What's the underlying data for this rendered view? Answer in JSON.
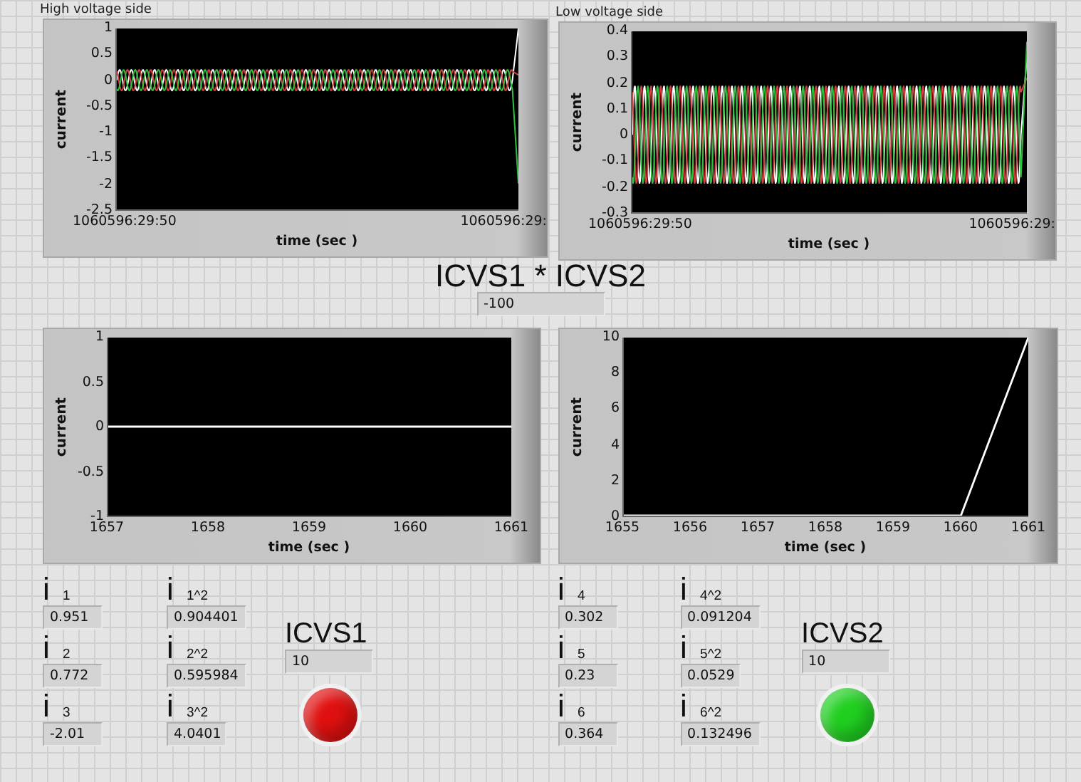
{
  "top_charts": [
    {
      "label": "High voltage side",
      "ylabel": "current",
      "xlabel": "time (sec )",
      "y_ticks": [
        "1",
        "0.5",
        "0",
        "-0.5",
        "-1",
        "-1.5",
        "-2",
        "-2.5"
      ],
      "x_labels": [
        "1060596:29:50",
        "1060596:29:"
      ]
    },
    {
      "label": "Low voltage side",
      "ylabel": "current",
      "xlabel": "time (sec )",
      "y_ticks": [
        "0.4",
        "0.3",
        "0.2",
        "0.1",
        "0",
        "-0.1",
        "-0.2",
        "-0.3"
      ],
      "x_labels": [
        "1060596:29:50",
        "1060596:29:"
      ]
    }
  ],
  "product": {
    "title": "ICVS1 * ICVS2",
    "value": "-100"
  },
  "bottom_charts": [
    {
      "chart_data": {
        "type": "line",
        "xlabel": "time (sec )",
        "ylabel": "current",
        "x": [
          1657,
          1661
        ],
        "series": [
          {
            "color": "#ffffff",
            "values": [
              0,
              0
            ]
          }
        ],
        "xlim": [
          1657,
          1661
        ],
        "ylim": [
          -1,
          1
        ],
        "xticks": [
          1657,
          1658,
          1659,
          1660,
          1661
        ],
        "yticks": [
          -1,
          -0.5,
          0,
          0.5,
          1
        ]
      }
    },
    {
      "chart_data": {
        "type": "line",
        "xlabel": "time (sec )",
        "ylabel": "current",
        "x": [
          1655,
          1660,
          1661
        ],
        "series": [
          {
            "color": "#ffffff",
            "values": [
              0,
              0,
              10
            ]
          }
        ],
        "xlim": [
          1655,
          1661
        ],
        "ylim": [
          0,
          10
        ],
        "xticks": [
          1655,
          1656,
          1657,
          1658,
          1659,
          1660,
          1661
        ],
        "yticks": [
          0,
          2,
          4,
          6,
          8,
          10
        ]
      }
    }
  ],
  "groups": [
    {
      "currents": [
        {
          "label": "i $_{1}$",
          "value": "0.951"
        },
        {
          "label": "i $_{2}$",
          "value": "0.772"
        },
        {
          "label": "i $_{3}$",
          "value": "-2.01"
        }
      ],
      "squares": [
        {
          "label": "i $_{1^2}$",
          "value": "0.904401"
        },
        {
          "label": "i $_{2^2}$",
          "value": "0.595984"
        },
        {
          "label": "i $_{3^2}$",
          "value": "4.0401"
        }
      ],
      "source": {
        "title": "ICVS1",
        "value": "10",
        "color": "#e01010"
      }
    },
    {
      "currents": [
        {
          "label": "i $_{4}$",
          "value": "0.302"
        },
        {
          "label": "i $_{5}$",
          "value": "0.23"
        },
        {
          "label": "i $_{6}$",
          "value": "0.364"
        }
      ],
      "squares": [
        {
          "label": "i $_{4^2}$",
          "value": "0.091204"
        },
        {
          "label": "i $_{5^2}$",
          "value": "0.0529"
        },
        {
          "label": "i $_{6^2}$",
          "value": "0.132496"
        }
      ],
      "source": {
        "title": "ICVS2",
        "value": "10",
        "color": "#20d020"
      }
    }
  ]
}
